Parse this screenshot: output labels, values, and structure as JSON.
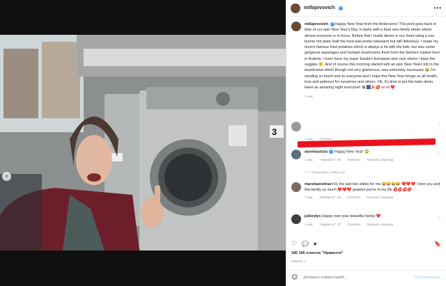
{
  "close_icon": "×",
  "media": {
    "nav_prev": "‹",
    "dots": [
      1,
      2,
      3,
      4,
      5,
      6,
      7,
      8,
      9,
      10
    ],
    "active_dot": 0,
    "label_3": "3"
  },
  "post": {
    "username": "millajovovich",
    "more": "•••",
    "caption_user": "millajovovich",
    "caption": "Happy New Year from the Andersons! This post goes back in time of our epic New Year's Day. It starts with a hard won family photo where almost everyone is in focus. Before that I made dinner in our hotel using a one burner hot plate (half the food was pretty lukewarm but still delicious). I made my mom's famous fried potatoes which is always a hit with the kids, but also some gorgeous asparagus and trumpet mushrooms fresh from the farmers market here in Krakow. I even have my super Eastern European wire rack where I keep the veggies 🙂. And of course this morning started with an epic New Years trip to the laundromat which though not very glamorous, was extremely necessary 😅 I'm sending so much love to everyone and I hope this New Year brings us all health, love and patience for ourselves and others. Ok, it's time to put the baby down. Have an amazing night everyone! 👏🏽🎆🎉💋 xo m ❤️",
    "caption_time": "1 нед."
  },
  "comments": [
    {
      "user": "",
      "text": "",
      "time": "1 нед.",
      "likes": "",
      "reply": "Ответить",
      "redacted": true
    },
    {
      "user": "davebautista",
      "text": "Happy New Year! 😱",
      "time": "1 нед.",
      "likes": "\"Нравится\": 50",
      "reply": "Ответить",
      "translate": "Показать перевод",
      "replies": "Посмотреть ответы (1)"
    },
    {
      "user": "marshamolinari",
      "text": "It's the last two slides for me 😂😂😂😂 ❤️❤️❤️ I love you and this family so much ❤️❤️❤️ grateful you're in my life 💋💋💋💋",
      "time": "1 нед.",
      "likes": "\"Нравится\": 18",
      "reply": "Ответить",
      "translate": "Показать перевод"
    },
    {
      "user": "juliendys",
      "text": "Happy new year beautiful family ❤️",
      "time": "1 нед.",
      "likes": "\"Нравится\": 37",
      "reply": "Ответить",
      "translate": "Показать перевод"
    }
  ],
  "actions": {
    "like_icon": "♡",
    "comment_icon": "💬",
    "share_icon": "➤",
    "save_icon": "🔖"
  },
  "likes_text": "185 196 отметок \"Нравится\"",
  "time_ago": "ЯНВАРЬ 1",
  "add_comment": {
    "emoji_icon": "☺",
    "placeholder": "Добавьте комментарий...",
    "publish_label": "Опубликовать"
  },
  "colors": {
    "verified": "#3897f0",
    "redaction": "#e8131c",
    "heart": "#ed4956"
  }
}
